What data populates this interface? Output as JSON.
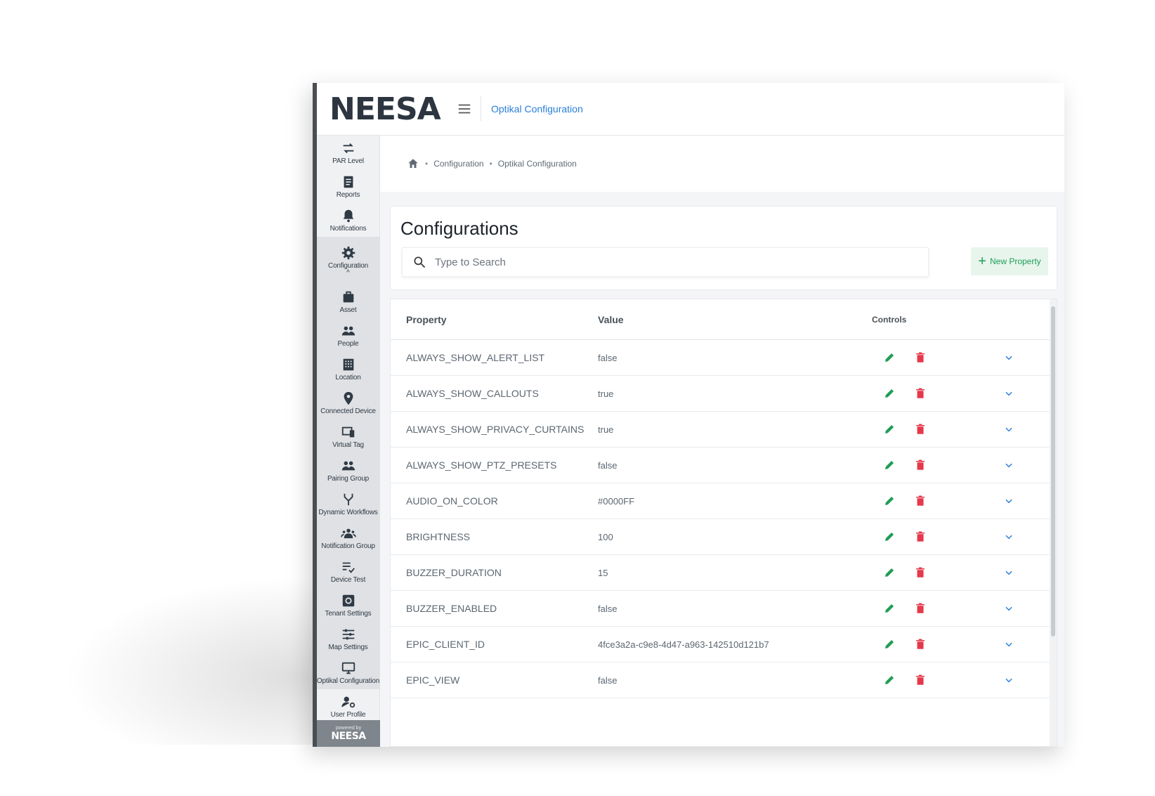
{
  "brand": {
    "logo": "NEESA",
    "powered_by": "powered by",
    "powered_logo": "NEESA"
  },
  "header": {
    "page_link": "Optikal Configuration"
  },
  "sidebar": {
    "items": [
      {
        "label": "PAR Level",
        "icon": "swap-arrows-icon"
      },
      {
        "label": "Reports",
        "icon": "report-icon"
      },
      {
        "label": "Notifications",
        "icon": "bell-icon"
      },
      {
        "label": "Configuration",
        "icon": "gear-icon",
        "caret": "^"
      },
      {
        "label": "Asset",
        "icon": "briefcase-icon"
      },
      {
        "label": "People",
        "icon": "people-icon"
      },
      {
        "label": "Location",
        "icon": "building-icon"
      },
      {
        "label": "Connected Device",
        "icon": "map-pin-icon"
      },
      {
        "label": "Virtual Tag",
        "icon": "devices-icon"
      },
      {
        "label": "Pairing Group",
        "icon": "group-icon"
      },
      {
        "label": "Dynamic Workflows",
        "icon": "merge-icon"
      },
      {
        "label": "Notification Group",
        "icon": "groups-icon"
      },
      {
        "label": "Device Test",
        "icon": "checklist-icon"
      },
      {
        "label": "Tenant Settings",
        "icon": "settings-box-icon"
      },
      {
        "label": "Map Settings",
        "icon": "sliders-icon"
      },
      {
        "label": "Optikal Configuration",
        "icon": "monitor-icon"
      },
      {
        "label": "User Profile",
        "icon": "user-gear-icon"
      }
    ]
  },
  "breadcrumb": {
    "items": [
      "Configuration",
      "Optikal Configuration"
    ],
    "separator": "•"
  },
  "main": {
    "title": "Configurations",
    "search_placeholder": "Type to Search",
    "new_button": "New Property",
    "new_button_icon": "+"
  },
  "table": {
    "headers": {
      "property": "Property",
      "value": "Value",
      "controls": "Controls"
    },
    "rows": [
      {
        "property": "ALWAYS_SHOW_ALERT_LIST",
        "value": "false"
      },
      {
        "property": "ALWAYS_SHOW_CALLOUTS",
        "value": "true"
      },
      {
        "property": "ALWAYS_SHOW_PRIVACY_CURTAINS",
        "value": "true"
      },
      {
        "property": "ALWAYS_SHOW_PTZ_PRESETS",
        "value": "false"
      },
      {
        "property": "AUDIO_ON_COLOR",
        "value": "#0000FF"
      },
      {
        "property": "BRIGHTNESS",
        "value": "100"
      },
      {
        "property": "BUZZER_DURATION",
        "value": "15"
      },
      {
        "property": "BUZZER_ENABLED",
        "value": "false"
      },
      {
        "property": "EPIC_CLIENT_ID",
        "value": "4fce3a2a-c9e8-4d47-a963-142510d121b7"
      },
      {
        "property": "EPIC_VIEW",
        "value": "false"
      }
    ]
  },
  "colors": {
    "edit": "#1f9d55",
    "delete": "#e5384b",
    "expand": "#2a7fd8",
    "link": "#2a7fd8",
    "sidebar_icon": "#2f3a45"
  }
}
